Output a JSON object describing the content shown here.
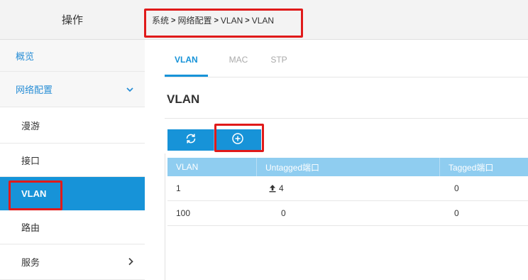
{
  "sidebar": {
    "header": "操作",
    "items": [
      {
        "label": "概览"
      },
      {
        "label": "网络配置"
      },
      {
        "label": "漫游"
      },
      {
        "label": "接口"
      },
      {
        "label": "VLAN"
      },
      {
        "label": "路由"
      },
      {
        "label": "服务"
      }
    ]
  },
  "breadcrumb": {
    "parts": [
      "系统",
      "网络配置",
      "VLAN",
      "VLAN"
    ],
    "separator": ">"
  },
  "tabs": [
    {
      "label": "VLAN"
    },
    {
      "label": "MAC"
    },
    {
      "label": "STP"
    }
  ],
  "section": {
    "title": "VLAN"
  },
  "toolbar": {
    "refresh_icon": "refresh-icon",
    "add_icon": "add-circle-icon"
  },
  "table": {
    "headers": [
      "VLAN",
      "Untagged端口",
      "Tagged端口"
    ],
    "rows": [
      {
        "vlan": "1",
        "untagged": "4",
        "tagged": "0"
      },
      {
        "vlan": "100",
        "untagged": "0",
        "tagged": "0"
      }
    ]
  },
  "colors": {
    "accent": "#1793d8",
    "header_row": "#8fcdf0",
    "annotation": "#e01a1a"
  }
}
